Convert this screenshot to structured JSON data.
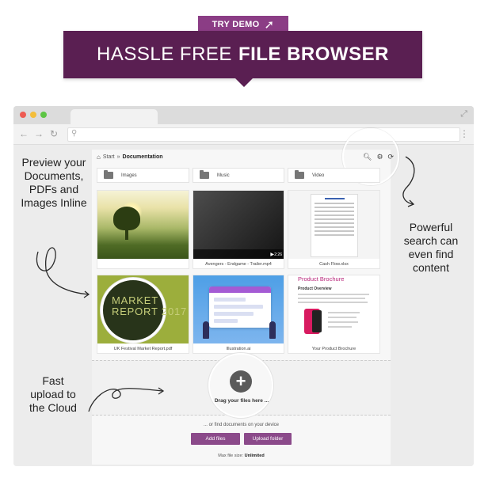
{
  "hero": {
    "try_demo": "TRY DEMO",
    "title_light": "HASSLE FREE",
    "title_bold": "FILE BROWSER"
  },
  "annotations": {
    "left_top": "Preview your Documents, PDFs and Images Inline",
    "right_mid": "Powerful search can even find content",
    "left_bottom": "Fast upload to the Cloud"
  },
  "breadcrumb": {
    "start": "Start",
    "separator": "»",
    "current": "Documentation"
  },
  "toolbar": {
    "search_icon": "search-icon",
    "settings_icon": "gear-icon",
    "refresh_icon": "refresh-icon"
  },
  "folders": [
    {
      "label": "Images"
    },
    {
      "label": "Music"
    },
    {
      "label": "Video"
    }
  ],
  "files": [
    {
      "caption": ""
    },
    {
      "caption": "Avengers - Endgame - Trailer.mp4",
      "duration": "2:26"
    },
    {
      "caption": "Cash Flow.xlsx"
    },
    {
      "caption": "UK Festival Market Report.pdf",
      "thumb_text": "MARKET REPORT 2017"
    },
    {
      "caption": "Illustration.ai"
    },
    {
      "caption": "Your Product Brochure",
      "thumb_title": "Product Brochure",
      "thumb_sub": "Product Overview"
    }
  ],
  "upload": {
    "drag_text": "Drag your files here ...",
    "or_find": "... or find documents on your device",
    "add_files": "Add files",
    "upload_folder": "Upload folder",
    "max_label": "Max file size:",
    "max_value": "Unlimited"
  }
}
